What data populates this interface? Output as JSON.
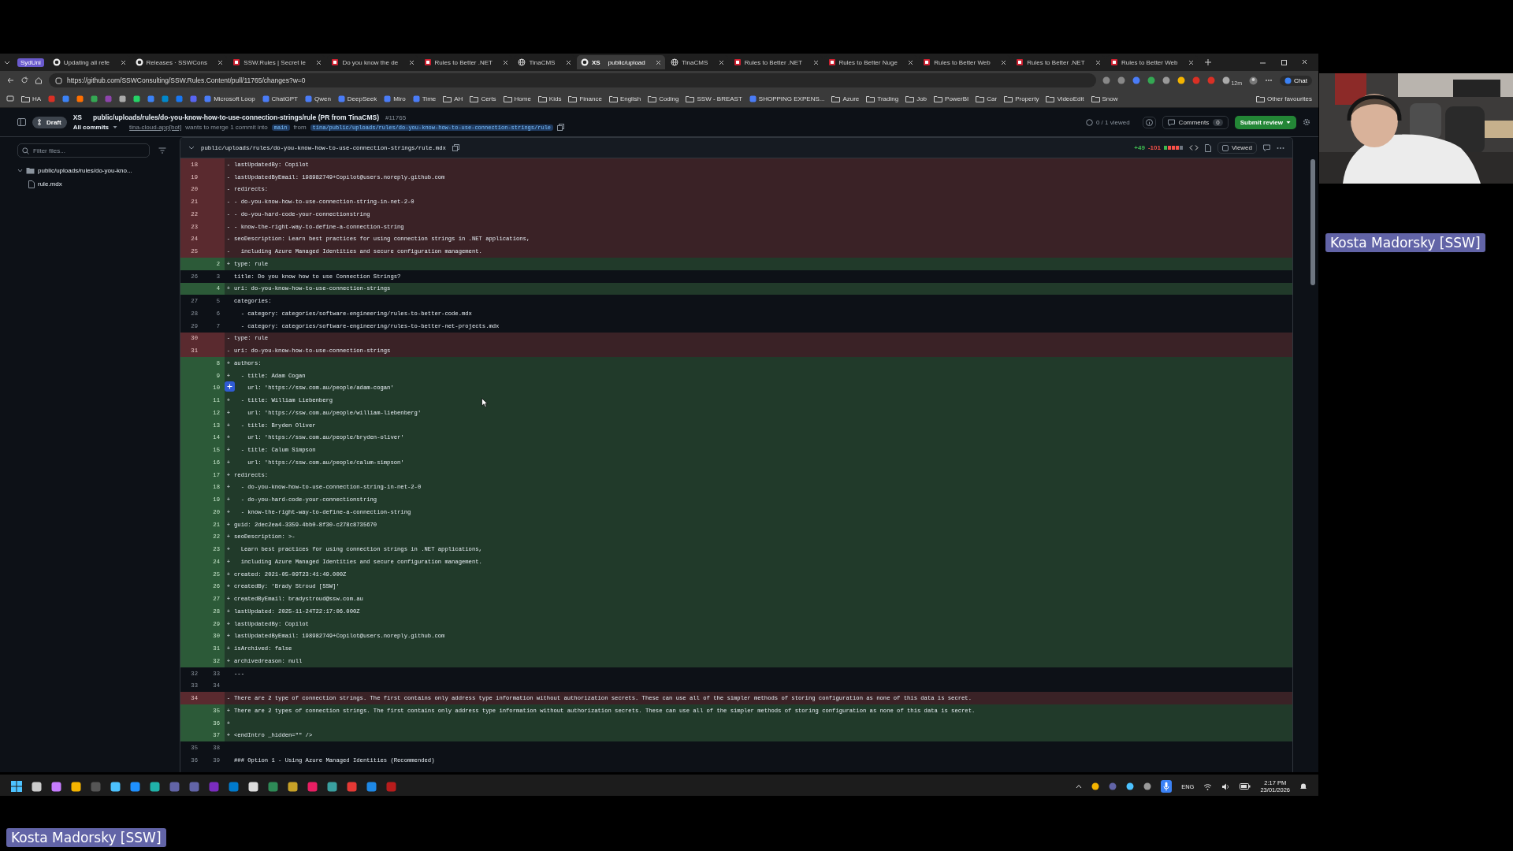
{
  "browser": {
    "workspace": "SydUni",
    "tabs": [
      {
        "kind": "github",
        "title": "Updating all refe",
        "selected": false
      },
      {
        "kind": "github",
        "title": "Releases · SSWCons",
        "selected": false
      },
      {
        "kind": "ssw",
        "title": "SSW.Rules | Secret le",
        "selected": false
      },
      {
        "kind": "ssw",
        "title": "Do you know the de",
        "selected": false
      },
      {
        "kind": "ssw",
        "title": "Rules to Better .NET",
        "selected": false
      },
      {
        "kind": "globe",
        "title": "TinaCMS",
        "selected": false
      },
      {
        "kind": "github",
        "prefix": "XS",
        "title": "public/upload",
        "selected": true
      },
      {
        "kind": "globe",
        "title": "TinaCMS",
        "selected": false
      },
      {
        "kind": "ssw",
        "title": "Rules to Better .NET",
        "selected": false
      },
      {
        "kind": "ssw",
        "title": "Rules to Better Nuge",
        "selected": false
      },
      {
        "kind": "ssw",
        "title": "Rules to Better Web",
        "selected": false
      },
      {
        "kind": "ssw",
        "title": "Rules to Better .NET",
        "selected": false
      },
      {
        "kind": "ssw",
        "title": "Rules to Better Web",
        "selected": false
      }
    ],
    "url": "https://github.com/SSWConsulting/SSW.Rules.Content/pull/11765/changes?w=0",
    "extension_badge": "12m",
    "chat": "Chat",
    "bookmarks": [
      {
        "kind": "folder",
        "label": "HA"
      },
      {
        "kind": "site",
        "label": "Microsoft Loop"
      },
      {
        "kind": "site",
        "label": "ChatGPT"
      },
      {
        "kind": "site",
        "label": "Qwen"
      },
      {
        "kind": "site",
        "label": "DeepSeek"
      },
      {
        "kind": "site",
        "label": "Miro"
      },
      {
        "kind": "site",
        "label": "Time"
      },
      {
        "kind": "folder",
        "label": "AH"
      },
      {
        "kind": "folder",
        "label": "Certs"
      },
      {
        "kind": "folder",
        "label": "Home"
      },
      {
        "kind": "folder",
        "label": "Kids"
      },
      {
        "kind": "folder",
        "label": "Finance"
      },
      {
        "kind": "folder",
        "label": "English"
      },
      {
        "kind": "folder",
        "label": "Coding"
      },
      {
        "kind": "folder",
        "label": "SSW - BREAST"
      },
      {
        "kind": "site",
        "label": "SHOPPING EXPENS..."
      },
      {
        "kind": "folder",
        "label": "Azure"
      },
      {
        "kind": "folder",
        "label": "Trading"
      },
      {
        "kind": "folder",
        "label": "Job"
      },
      {
        "kind": "folder",
        "label": "PowerBI"
      },
      {
        "kind": "folder",
        "label": "Car"
      },
      {
        "kind": "folder",
        "label": "Property"
      },
      {
        "kind": "folder",
        "label": "VideoEdit"
      },
      {
        "kind": "folder",
        "label": "Snow"
      }
    ],
    "other_favourites": "Other favourites"
  },
  "pr": {
    "status": "Draft",
    "repo_label": "XS",
    "title": "public/uploads/rules/do-you-know-how-to-use-connection-strings/rule (PR from TinaCMS)",
    "number": "#11765",
    "commits_menu": "All commits",
    "author": "tina-cloud-app[bot]",
    "merge_text": "wants to merge 1 commit into",
    "base": "main",
    "from_text": "from",
    "head": "tina/public/uploads/rules/do-you-know-how-to-use-connection-strings/rule",
    "viewed": "0 / 1 viewed",
    "comments_label": "Comments",
    "comments_count": "0",
    "submit": "Submit review"
  },
  "files": {
    "placeholder": "Filter files...",
    "tree": [
      {
        "kind": "folder",
        "name": "public/uploads/rules/do-you-kno...",
        "expanded": true,
        "children": [
          {
            "kind": "file",
            "name": "rule.mdx"
          }
        ]
      }
    ]
  },
  "diff": {
    "path": "public/uploads/rules/do-you-know-how-to-use-connection-strings/rule.mdx",
    "additions": "+49",
    "deletions": "-101",
    "viewed_label": "Viewed",
    "viewed": false,
    "rows": [
      {
        "kind": "del",
        "old": "18",
        "sign": "-",
        "text": "lastUpdatedBy: Copilot"
      },
      {
        "kind": "del",
        "old": "19",
        "sign": "-",
        "text": "lastUpdatedByEmail: 198982749+Copilot@users.noreply.github.com"
      },
      {
        "kind": "del",
        "old": "20",
        "sign": "-",
        "text": "redirects:"
      },
      {
        "kind": "del",
        "old": "21",
        "sign": "-",
        "text": "- do-you-know-how-to-use-connection-string-in-net-2-0"
      },
      {
        "kind": "del",
        "old": "22",
        "sign": "-",
        "text": "- do-you-hard-code-your-connectionstring"
      },
      {
        "kind": "del",
        "old": "23",
        "sign": "-",
        "text": "- know-the-right-way-to-define-a-connection-string"
      },
      {
        "kind": "del",
        "old": "24",
        "sign": "-",
        "text": "seoDescription: Learn best practices for using connection strings in .NET applications,"
      },
      {
        "kind": "del",
        "old": "25",
        "sign": "-",
        "text": "  including Azure Managed Identities and secure configuration management."
      },
      {
        "kind": "add",
        "new": "2",
        "sign": "+",
        "text": "type: rule"
      },
      {
        "kind": "ctx",
        "old": "26",
        "new": "3",
        "text": "title: Do you know how to use Connection Strings?"
      },
      {
        "kind": "add",
        "new": "4",
        "sign": "+",
        "text": "uri: do-you-know-how-to-use-connection-strings"
      },
      {
        "kind": "ctx",
        "old": "27",
        "new": "5",
        "text": "categories:"
      },
      {
        "kind": "ctx",
        "old": "28",
        "new": "6",
        "text": "  - category: categories/software-engineering/rules-to-better-code.mdx"
      },
      {
        "kind": "ctx",
        "old": "29",
        "new": "7",
        "text": "  - category: categories/software-engineering/rules-to-better-net-projects.mdx"
      },
      {
        "kind": "del",
        "old": "30",
        "sign": "-",
        "text": "type: rule"
      },
      {
        "kind": "del",
        "old": "31",
        "sign": "-",
        "text": "uri: do-you-know-how-to-use-connection-strings"
      },
      {
        "kind": "add",
        "new": "8",
        "sign": "+",
        "text": "authors:"
      },
      {
        "kind": "add",
        "new": "9",
        "sign": "+",
        "text": "  - title: Adam Cogan"
      },
      {
        "kind": "add",
        "new": "10",
        "text": "    url: 'https://ssw.com.au/people/adam-cogan'"
      },
      {
        "kind": "add",
        "new": "11",
        "sign": "+",
        "text": "  - title: William Liebenberg"
      },
      {
        "kind": "add",
        "new": "12",
        "sign": "+",
        "text": "    url: 'https://ssw.com.au/people/william-liebenberg'"
      },
      {
        "kind": "add",
        "new": "13",
        "sign": "+",
        "text": "  - title: Bryden Oliver"
      },
      {
        "kind": "add",
        "new": "14",
        "sign": "+",
        "text": "    url: 'https://ssw.com.au/people/bryden-oliver'"
      },
      {
        "kind": "add",
        "new": "15",
        "sign": "+",
        "text": "  - title: Calum Simpson"
      },
      {
        "kind": "add",
        "new": "16",
        "sign": "+",
        "text": "    url: 'https://ssw.com.au/people/calum-simpson'"
      },
      {
        "kind": "add",
        "new": "17",
        "sign": "+",
        "text": "redirects:"
      },
      {
        "kind": "add",
        "new": "18",
        "sign": "+",
        "text": "  - do-you-know-how-to-use-connection-string-in-net-2-0"
      },
      {
        "kind": "add",
        "new": "19",
        "sign": "+",
        "text": "  - do-you-hard-code-your-connectionstring"
      },
      {
        "kind": "add",
        "new": "20",
        "sign": "+",
        "text": "  - know-the-right-way-to-define-a-connection-string"
      },
      {
        "kind": "add",
        "new": "21",
        "sign": "+",
        "text": "guid: 2dec2ea4-3359-4bb0-8f30-c278c8735670"
      },
      {
        "kind": "add",
        "new": "22",
        "sign": "+",
        "text": "seoDescription: >-"
      },
      {
        "kind": "add",
        "new": "23",
        "sign": "+",
        "text": "  Learn best practices for using connection strings in .NET applications,"
      },
      {
        "kind": "add",
        "new": "24",
        "sign": "+",
        "text": "  including Azure Managed Identities and secure configuration management."
      },
      {
        "kind": "add",
        "new": "25",
        "sign": "+",
        "text": "created: 2021-05-09T23:41:49.000Z"
      },
      {
        "kind": "add",
        "new": "26",
        "sign": "+",
        "text": "createdBy: 'Brady Stroud [SSW]'"
      },
      {
        "kind": "add",
        "new": "27",
        "sign": "+",
        "text": "createdByEmail: bradystroud@ssw.com.au"
      },
      {
        "kind": "add",
        "new": "28",
        "sign": "+",
        "text": "lastUpdated: 2025-11-24T22:17:06.000Z"
      },
      {
        "kind": "add",
        "new": "29",
        "sign": "+",
        "text": "lastUpdatedBy: Copilot"
      },
      {
        "kind": "add",
        "new": "30",
        "sign": "+",
        "text": "lastUpdatedByEmail: 198982749+Copilot@users.noreply.github.com"
      },
      {
        "kind": "add",
        "new": "31",
        "sign": "+",
        "text": "isArchived: false"
      },
      {
        "kind": "add",
        "new": "32",
        "sign": "+",
        "text": "archivedreason: null"
      },
      {
        "kind": "ctx",
        "old": "32",
        "new": "33",
        "text": "---"
      },
      {
        "kind": "ctx",
        "old": "33",
        "new": "34"
      },
      {
        "kind": "del",
        "old": "34",
        "sign": "-",
        "text": "There are 2 type of connection strings. The first contains only address type information without authorization secrets. These can use all of the simpler methods of storing configuration as none of this data is secret."
      },
      {
        "kind": "add",
        "new": "35",
        "sign": "+",
        "text": "There are 2 types of connection strings. The first contains only address type information without authorization secrets. These can use all of the simpler methods of storing configuration as none of this data is secret."
      },
      {
        "kind": "add",
        "new": "36",
        "sign": "+"
      },
      {
        "kind": "add",
        "new": "37",
        "sign": "+",
        "text": "<endIntro _hidden=\"\" />"
      },
      {
        "kind": "ctx",
        "old": "35",
        "new": "38"
      },
      {
        "kind": "ctx",
        "old": "36",
        "new": "39",
        "text": "### Option 1 - Using Azure Managed Identities (Recommended)"
      }
    ]
  },
  "taskbar": {
    "language": "ENG",
    "time": "2:17 PM",
    "date": "23/01/2026"
  },
  "webcam": {
    "kind": "picture",
    "name": "Kosta Madorsky [SSW]"
  },
  "caption": "Kosta Madorsky [SSW]"
}
